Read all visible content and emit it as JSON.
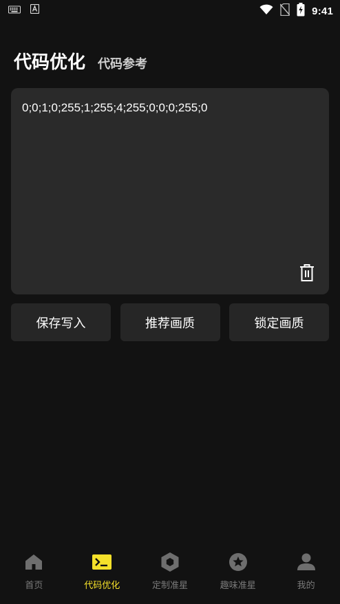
{
  "status_bar": {
    "time": "9:41",
    "icons": [
      "keyboard-icon",
      "text-icon",
      "wifi-icon",
      "no-sim-icon",
      "battery-charging-icon"
    ]
  },
  "header": {
    "title": "代码优化",
    "subtitle": "代码参考"
  },
  "code_box": {
    "value": "0;0;1;0;255;1;255;4;255;0;0;0;255;0",
    "clear_icon": "trash-icon"
  },
  "actions": {
    "save_write": "保存写入",
    "recommend_quality": "推荐画质",
    "lock_quality": "锁定画质"
  },
  "bottom_nav": {
    "items": [
      {
        "label": "首页",
        "icon": "home-icon"
      },
      {
        "label": "代码优化",
        "icon": "terminal-icon",
        "active": true
      },
      {
        "label": "定制准星",
        "icon": "hexagon-nut-icon"
      },
      {
        "label": "趣味准星",
        "icon": "star-badge-icon"
      },
      {
        "label": "我的",
        "icon": "person-icon"
      }
    ]
  },
  "colors": {
    "background": "#121212",
    "surface": "#2a2a2a",
    "button": "#262626",
    "accent": "#f5e12a",
    "inactive": "#7a7a7a"
  }
}
